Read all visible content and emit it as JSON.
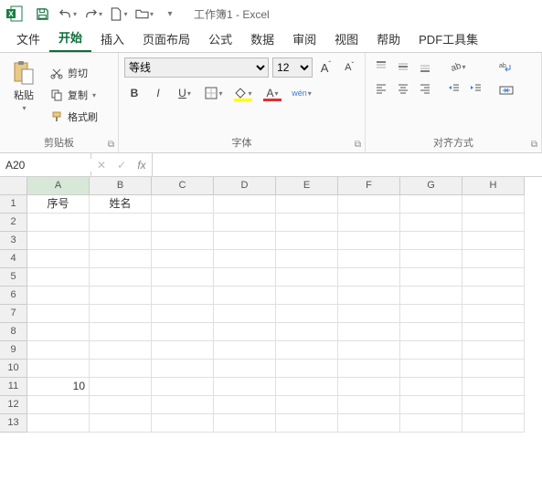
{
  "titlebar": {
    "title": "工作簿1  -  Excel"
  },
  "tabs": {
    "file": "文件",
    "home": "开始",
    "insert": "插入",
    "layout": "页面布局",
    "formulas": "公式",
    "data": "数据",
    "review": "审阅",
    "view": "视图",
    "help": "帮助",
    "pdftools": "PDF工具集"
  },
  "ribbon": {
    "clipboard": {
      "paste": "粘贴",
      "cut": "剪切",
      "copy": "复制",
      "format_painter": "格式刷",
      "group_label": "剪贴板"
    },
    "font": {
      "name": "等线",
      "size": "12",
      "bold": "B",
      "italic": "I",
      "underline": "U",
      "wen": "wén",
      "group_label": "字体"
    },
    "alignment": {
      "group_label": "对齐方式"
    }
  },
  "formula_bar": {
    "name_box": "A20",
    "fx": "fx",
    "formula": ""
  },
  "grid": {
    "columns": [
      "A",
      "B",
      "C",
      "D",
      "E",
      "F",
      "G",
      "H"
    ],
    "rows": [
      "1",
      "2",
      "3",
      "4",
      "5",
      "6",
      "7",
      "8",
      "9",
      "10",
      "11",
      "12",
      "13"
    ],
    "cells": {
      "A1": "序号",
      "B1": "姓名",
      "A11": "10"
    }
  }
}
